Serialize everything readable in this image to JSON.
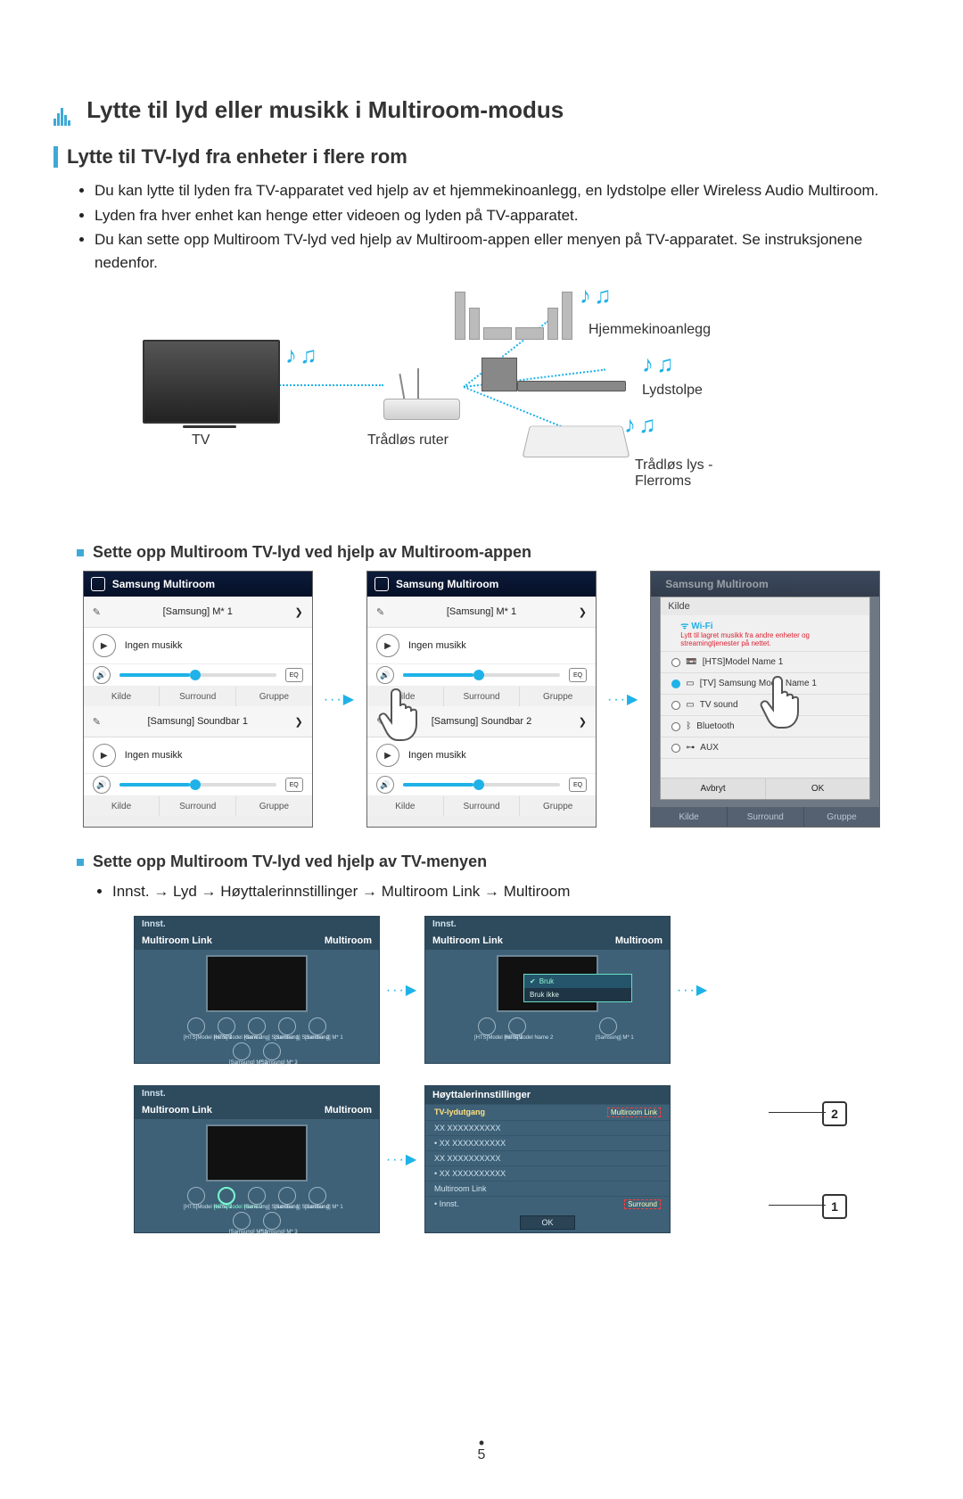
{
  "page_number": "5",
  "h1": "Lytte til lyd eller musikk i Multiroom-modus",
  "h2": "Lytte til TV-lyd fra enheter i flere rom",
  "bullets": [
    "Du kan lytte til lyden fra TV-apparatet ved hjelp av et hjemmekinoanlegg, en lydstolpe eller Wireless Audio Multiroom.",
    "Lyden fra hver enhet kan henge etter videoen og lyden på TV-apparatet.",
    "Du kan sette opp Multiroom TV-lyd ved hjelp av Multiroom-appen eller menyen på TV-apparatet. Se instruksjonene nedenfor."
  ],
  "diagram": {
    "tv": "TV",
    "router": "Trådløs ruter",
    "hts": "Hjemmekinoanlegg",
    "soundbar": "Lydstolpe",
    "speaker": "Trådløs lys -\nFlerroms"
  },
  "section_app": "Sette opp Multiroom TV-lyd ved hjelp av Multiroom-appen",
  "app": {
    "header": "Samsung Multiroom",
    "speaker1": "[Samsung] M* 1",
    "no_music": "Ingen musikk",
    "seg_source": "Kilde",
    "seg_surround": "Surround",
    "seg_group": "Gruppe",
    "soundbar1": "[Samsung] Soundbar 1",
    "soundbar2": "[Samsung] Soundbar 2",
    "eq": "EQ",
    "chev": "❯"
  },
  "source_dialog": {
    "title": "Kilde",
    "wifi_title": "Wi-Fi",
    "wifi_sub": "Lytt til lagret musikk fra andre enheter og streamingtjenester på nettet.",
    "hts": "[HTS]Model Name 1",
    "tv": "[TV] Samsung Model Name 1",
    "tvsound": "TV sound",
    "bt": "Bluetooth",
    "aux": "AUX",
    "cancel": "Avbryt",
    "ok": "OK"
  },
  "section_tvmenu": "Sette opp Multiroom TV-lyd ved hjelp av TV-menyen",
  "tvmenu_path": {
    "p1": "Innst.",
    "p2": "Lyd",
    "p3": "Høyttalerinnstillinger",
    "p4": "Multiroom Link",
    "p5": "Multiroom"
  },
  "tvpanel": {
    "crumb": "Innst.",
    "title_left": "Multiroom Link",
    "title_right": "Multiroom",
    "devices": {
      "d1": "[HTS]Model Name 1",
      "d2": "[HTS]Model Name 2",
      "d3": "[Samsung] Soundbar 1",
      "d4": "[Samsung] Soundbar 2",
      "d5": "[Samsung] M* 1",
      "d6": "[Samsung] M* 2",
      "d7": "[Samsung] M* 3"
    },
    "popup_use": "Bruk",
    "popup_dont": "Bruk ikke"
  },
  "speaker_settings": {
    "title": "Høyttalerinnstillinger",
    "row1_left": "TV-lydutgang",
    "row1_right": "Multiroom Link",
    "rows_x": "XX XXXXXXXXXX",
    "rows_x_bullet": "• XX XXXXXXXXXX",
    "row_ml": "Multiroom Link",
    "row_innst_left": "• Innst.",
    "row_innst_right": "Surround",
    "ok": "OK"
  },
  "callouts": {
    "one": "1",
    "two": "2"
  }
}
